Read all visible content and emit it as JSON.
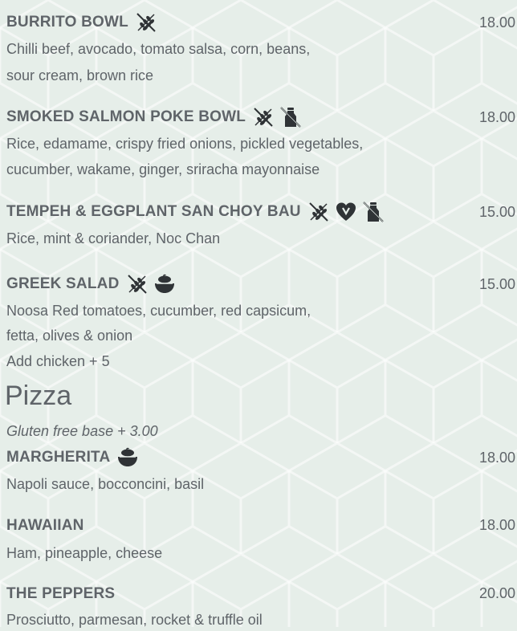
{
  "items": [
    {
      "name": "BURRITO BOWL",
      "price": "18.00",
      "desc": [
        "Chilli beef, avocado, tomato salsa, corn, beans,",
        "sour cream, brown rice"
      ]
    },
    {
      "name": "SMOKED SALMON POKE BOWL",
      "price": "18.00",
      "desc": [
        "Rice, edamame, crispy fried onions,  pickled vegetables,",
        "cucumber, wakame, ginger, sriracha mayonnaise"
      ]
    },
    {
      "name": "TEMPEH & EGGPLANT SAN CHOY BAU",
      "price": "15.00",
      "desc": [
        "Rice, mint & coriander, Noc Chan"
      ]
    },
    {
      "name": "GREEK SALAD",
      "price": "15.00",
      "desc": [
        "Noosa Red tomatoes, cucumber, red capsicum,",
        "fetta, olives & onion",
        "Add chicken + 5"
      ]
    },
    {
      "name": "MARGHERITA",
      "price": "18.00",
      "desc": [
        "Napoli sauce, bocconcini, basil"
      ]
    },
    {
      "name": "HAWAIIAN",
      "price": "18.00",
      "desc": [
        "Ham, pineapple, cheese"
      ]
    },
    {
      "name": "THE PEPPERS",
      "price": "20.00",
      "desc": [
        "Prosciutto, parmesan, rocket & truffle oil"
      ]
    }
  ],
  "pizza_section": {
    "title": "Pizza",
    "note": "Gluten free base + 3.00"
  },
  "icons": {
    "gluten_free": "gluten-free-icon",
    "dairy_free": "dairy-free-icon",
    "vegan": "vegan-heart-icon",
    "vegetarian": "vegetarian-bowl-icon"
  },
  "colors": {
    "background": "#e6eee9",
    "text": "#5f6469",
    "icon": "#2f3336"
  }
}
